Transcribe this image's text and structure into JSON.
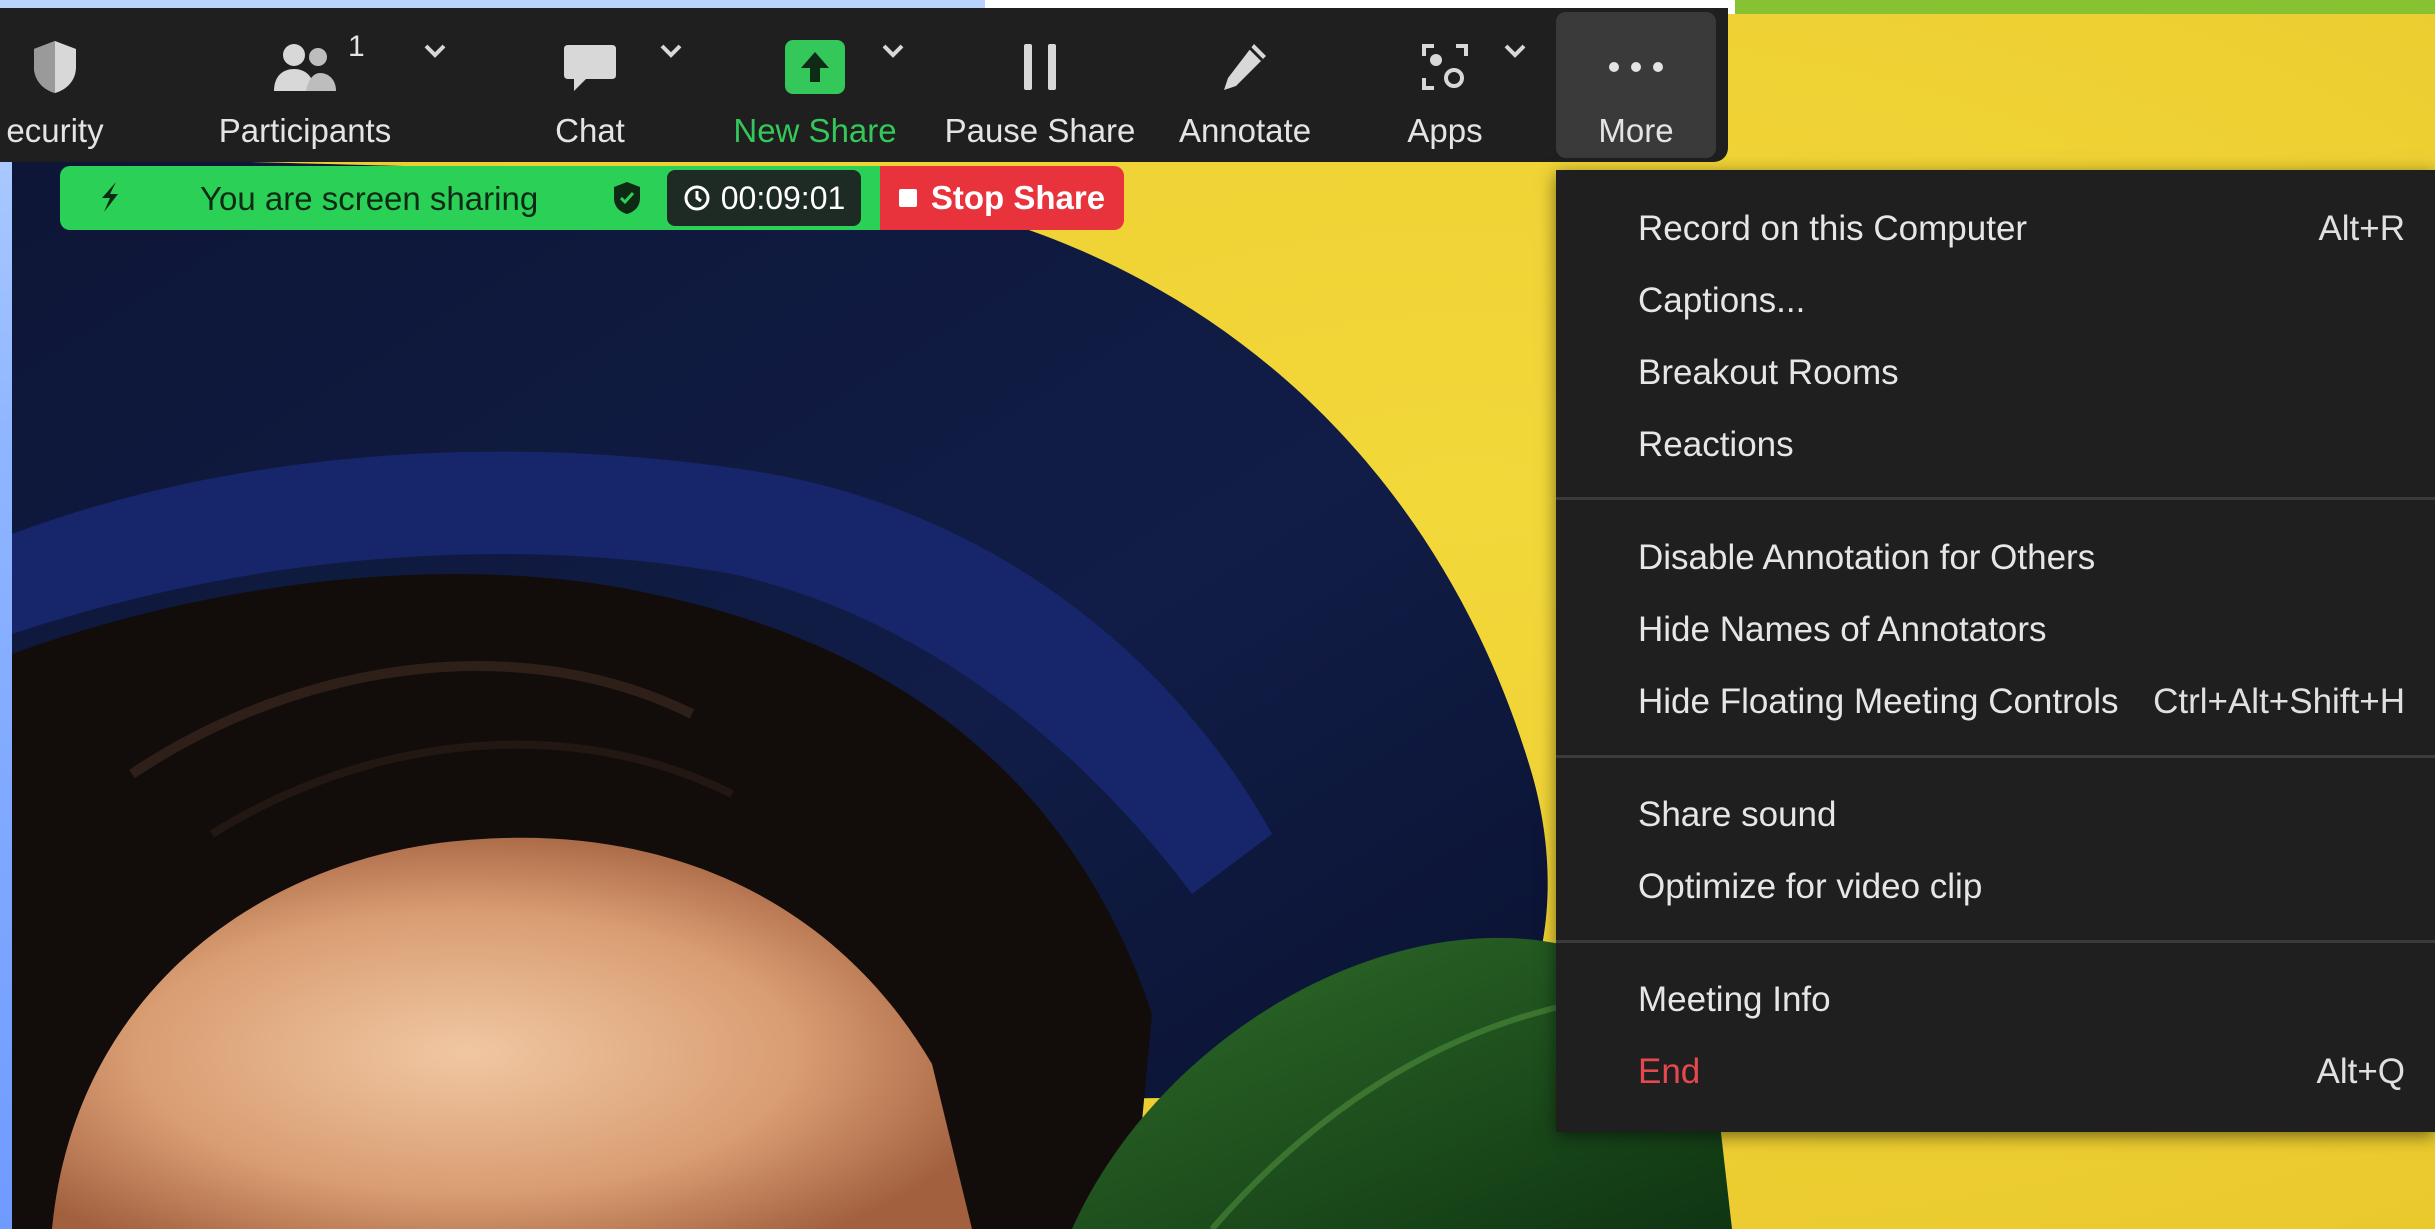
{
  "toolbar": {
    "security": "ecurity",
    "participants": "Participants",
    "participants_count": "1",
    "chat": "Chat",
    "new_share": "New Share",
    "pause_share": "Pause Share",
    "annotate": "Annotate",
    "apps": "Apps",
    "more": "More"
  },
  "sharing_bar": {
    "status": "You are screen sharing",
    "timer": "00:09:01",
    "stop": "Stop Share"
  },
  "more_menu": {
    "groups": [
      [
        {
          "label": "Record on this Computer",
          "shortcut": "Alt+R"
        },
        {
          "label": "Captions...",
          "shortcut": ""
        },
        {
          "label": "Breakout Rooms",
          "shortcut": ""
        },
        {
          "label": "Reactions",
          "shortcut": ""
        }
      ],
      [
        {
          "label": "Disable Annotation for Others",
          "shortcut": ""
        },
        {
          "label": "Hide Names of Annotators",
          "shortcut": ""
        },
        {
          "label": "Hide Floating Meeting Controls",
          "shortcut": "Ctrl+Alt+Shift+H"
        }
      ],
      [
        {
          "label": "Share sound",
          "shortcut": ""
        },
        {
          "label": "Optimize for video clip",
          "shortcut": ""
        }
      ],
      [
        {
          "label": "Meeting Info",
          "shortcut": ""
        },
        {
          "label": "End",
          "shortcut": "Alt+Q"
        }
      ]
    ]
  },
  "colors": {
    "toolbar_bg": "#1f1f1f",
    "share_green": "#2bd157",
    "stop_red": "#e8323c",
    "menu_bg": "#1f1f1f",
    "end_red": "#e5484d",
    "new_share_green": "#34c759"
  }
}
